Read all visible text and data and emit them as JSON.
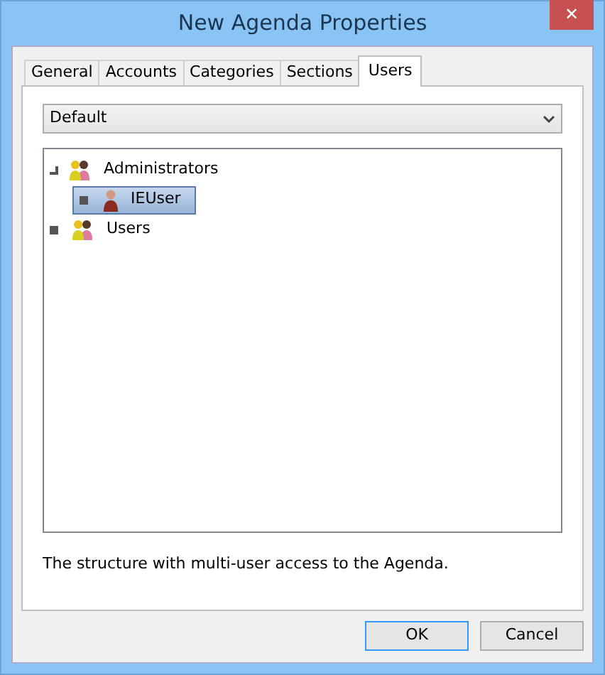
{
  "window": {
    "title": "New Agenda Properties",
    "close": "✕"
  },
  "tabs": [
    {
      "label": "General",
      "selected": false
    },
    {
      "label": "Accounts",
      "selected": false
    },
    {
      "label": "Categories",
      "selected": false
    },
    {
      "label": "Sections",
      "selected": false
    },
    {
      "label": "Users",
      "selected": true
    }
  ],
  "dropdown": {
    "value": "Default"
  },
  "tree": [
    {
      "label": "Administrators",
      "kind": "group",
      "expanded": true,
      "selected": false,
      "children": [
        {
          "label": "IEUser",
          "kind": "user",
          "expanded": false,
          "selected": true
        }
      ]
    },
    {
      "label": "Users",
      "kind": "group",
      "expanded": false,
      "selected": false
    }
  ],
  "description": "The structure with multi-user access to the Agenda.",
  "buttons": [
    {
      "label": "OK",
      "default": true
    },
    {
      "label": "Cancel",
      "default": false
    }
  ]
}
